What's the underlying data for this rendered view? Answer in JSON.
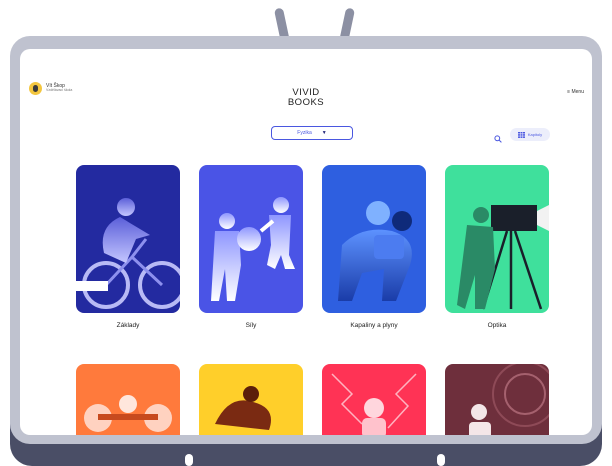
{
  "user": {
    "name": "Vít Škop",
    "school": "Vzdělávací škola"
  },
  "logo": {
    "line1": "VIVID",
    "line2": "BOOKS"
  },
  "menu": {
    "label": "≡ Menu"
  },
  "filter": {
    "subject": "Fyzika",
    "categories_label": "Kapitoly"
  },
  "icons": {
    "search": "search-icon",
    "grid": "grid-icon",
    "caret": "caret-down-icon",
    "menu": "menu-icon"
  },
  "colors": {
    "accent": "#4a57e0",
    "frame": "#bfc2cf",
    "frame_dark": "#4a4e66"
  },
  "chapters": [
    {
      "title": "Základy",
      "color": "#232aa0"
    },
    {
      "title": "Síly",
      "color": "#4a54e6"
    },
    {
      "title": "Kapaliny a plyny",
      "color": "#2e5fe0"
    },
    {
      "title": "Optika",
      "color": "#3fe09c"
    }
  ],
  "chapters_next": [
    {
      "color": "#ff7a3c"
    },
    {
      "color": "#ffcf2a"
    },
    {
      "color": "#ff3355"
    },
    {
      "color": "#6e2f3c"
    }
  ]
}
